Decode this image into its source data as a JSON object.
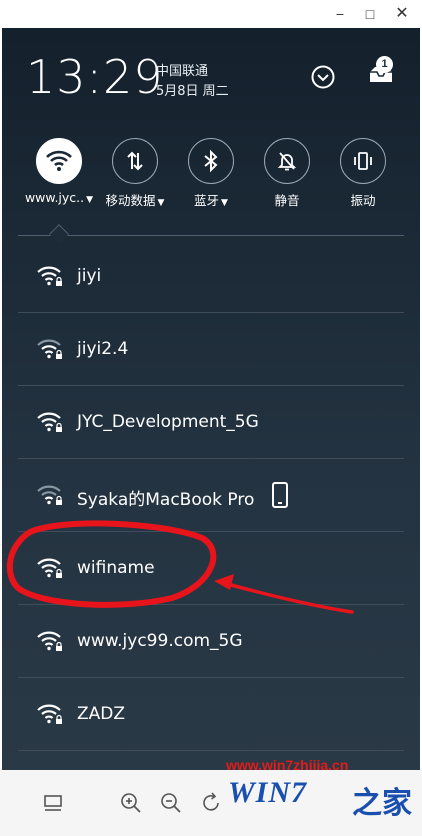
{
  "window": {
    "minimize": "−",
    "maximize": "□",
    "close": "✕"
  },
  "header": {
    "time": "13:29",
    "carrier": "中国联通",
    "date": "5月8日 周二",
    "notification_count": "1"
  },
  "toggles": [
    {
      "label": "www.jyc..",
      "has_caret": true,
      "active": true,
      "icon": "wifi-icon"
    },
    {
      "label": "移动数据",
      "has_caret": true,
      "active": false,
      "icon": "mobile-data-icon"
    },
    {
      "label": "蓝牙",
      "has_caret": true,
      "active": false,
      "icon": "bluetooth-icon"
    },
    {
      "label": "静音",
      "has_caret": false,
      "active": false,
      "icon": "mute-icon"
    },
    {
      "label": "振动",
      "has_caret": false,
      "active": false,
      "icon": "vibrate-icon"
    }
  ],
  "caret": "▼",
  "wifi_networks": [
    {
      "ssid": "jiyi"
    },
    {
      "ssid": "jiyi2.4"
    },
    {
      "ssid": "JYC_Development_5G"
    },
    {
      "ssid": "Syaka的MacBook Pro",
      "device_icon": "phone-icon"
    },
    {
      "ssid": "wifiname",
      "highlighted": true
    },
    {
      "ssid": "www.jyc99.com_5G"
    },
    {
      "ssid": "ZADZ"
    }
  ],
  "annotation_color": "#e8141c",
  "watermark": {
    "url": "www.win7zhijia.cn",
    "logo": "WIN7",
    "logo_cn": "之家"
  },
  "toolbar_icons": [
    "layout-icon",
    "zoom-in-icon",
    "zoom-out-icon",
    "rotate-icon"
  ]
}
